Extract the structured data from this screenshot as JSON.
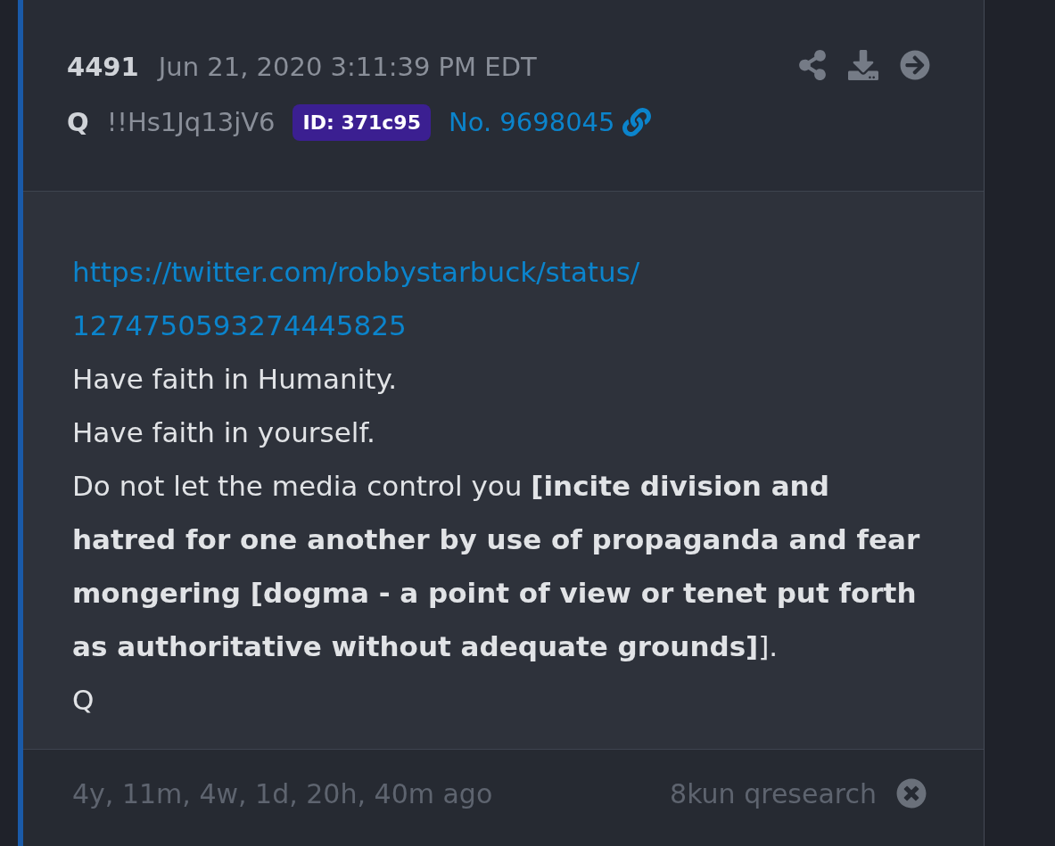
{
  "post": {
    "number": "4491",
    "date": "Jun 21, 2020 3:11:39 PM EDT",
    "author": "Q",
    "tripcode": "!!Hs1Jq13jV6",
    "id_badge": "ID: 371c95",
    "post_link": "No. 9698045"
  },
  "body": [
    {
      "kind": "link",
      "text": "https://twitter.com/robbystarbuck/status/1274750593274445825"
    },
    {
      "kind": "text",
      "text": "Have faith in Humanity."
    },
    {
      "kind": "text",
      "text": "Have faith in yourself."
    },
    {
      "kind": "text",
      "text": "Do not let the media control you **[incite division and hatred for one another by use of propaganda and fear mongering [dogma - a point of view or tenet put forth as authoritative without adequate grounds]**]."
    },
    {
      "kind": "text",
      "text": "Q"
    }
  ],
  "footer": {
    "age": "4y, 11m, 4w, 1d, 20h, 40m ago",
    "source": "8kun qresearch"
  }
}
